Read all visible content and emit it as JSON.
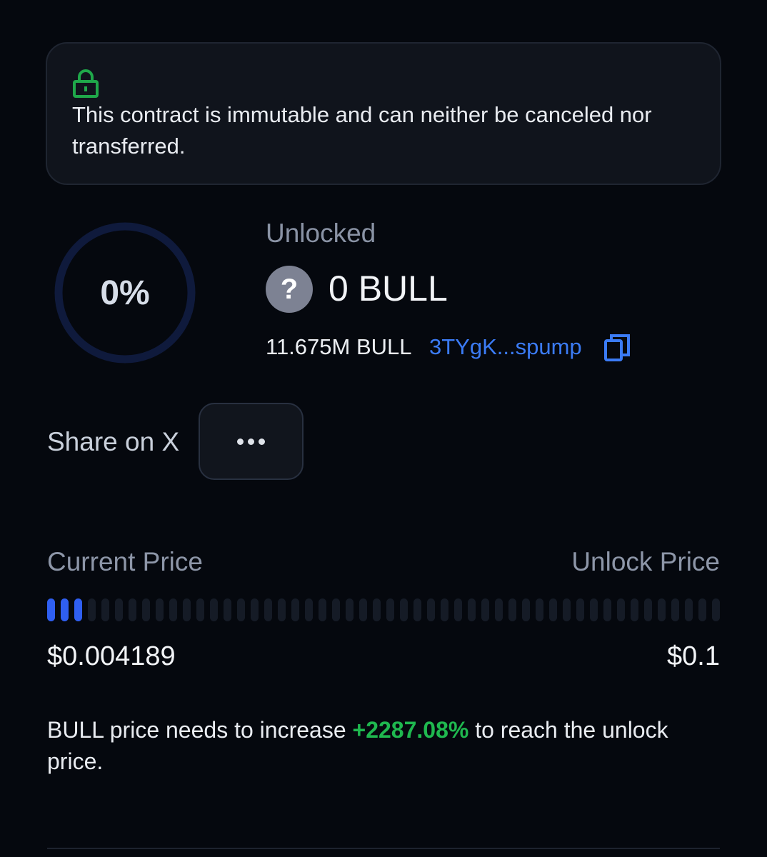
{
  "notice": {
    "icon": "lock-icon",
    "icon_color": "#1fa84a",
    "text": "This contract is immutable and can neither be canceled nor transferred."
  },
  "progress_ring": {
    "label": "0%",
    "percent": 0,
    "track_color": "#0f1a3c"
  },
  "unlocked": {
    "label": "Unlocked",
    "token_icon": "question-mark-icon",
    "token_icon_glyph": "?",
    "amount": "0 BULL",
    "total": "11.675M BULL",
    "address": "3TYgK...spump",
    "copy_icon": "copy-icon"
  },
  "actions": {
    "share_label": "Share on X",
    "more_icon": "more-horizontal-icon"
  },
  "price": {
    "current_label": "Current Price",
    "unlock_label": "Unlock Price",
    "current_value": "$0.004189",
    "unlock_value": "$0.1",
    "progress_fraction": 0.042,
    "active_color": "#2f5ff2",
    "inactive_color": "#151b26"
  },
  "increase": {
    "prefix": "BULL price needs to increase ",
    "percent": "+2287.08%",
    "suffix": " to reach the unlock price.",
    "percent_color": "#1fb84f"
  }
}
